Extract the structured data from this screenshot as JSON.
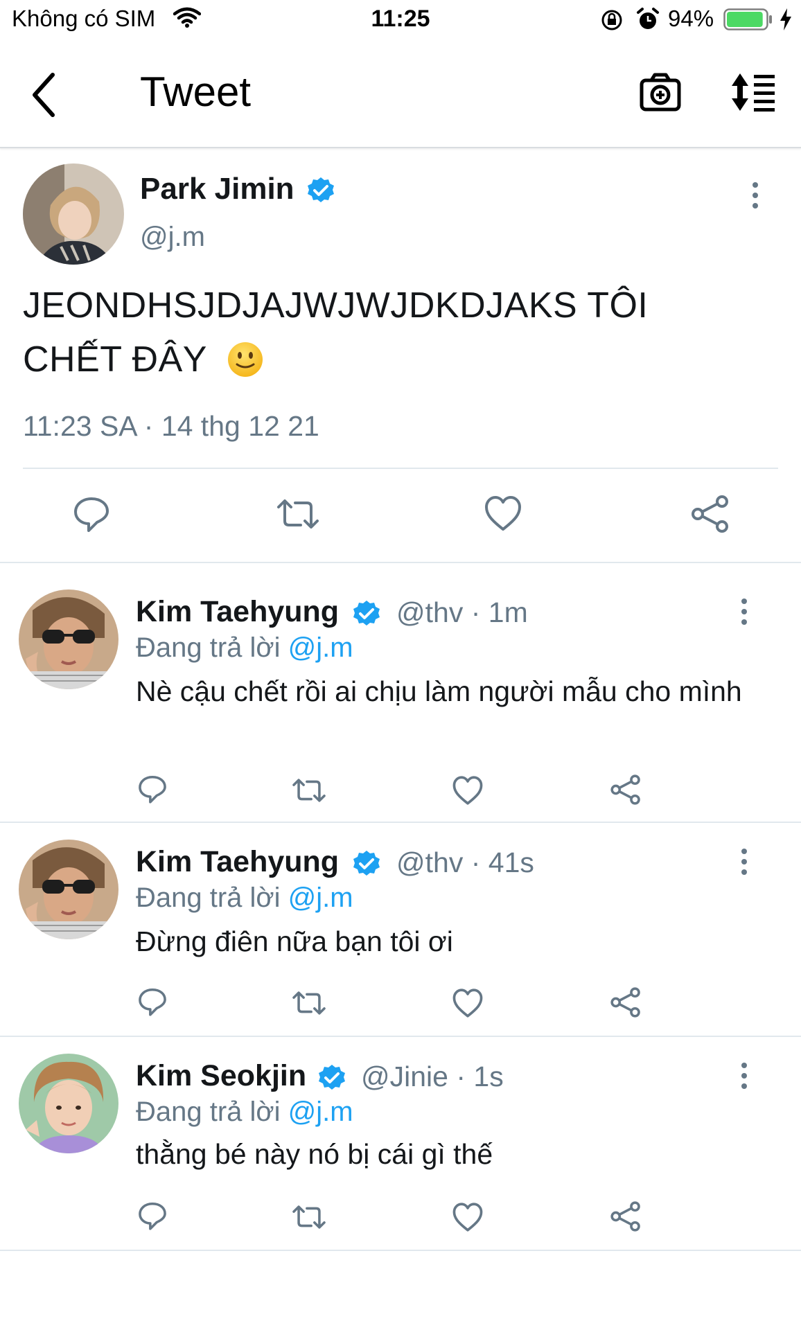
{
  "status_bar": {
    "carrier": "Không có SIM",
    "time": "11:25",
    "battery_percent": "94%",
    "battery_level": 0.94
  },
  "nav": {
    "title": "Tweet",
    "back_icon": "chevron-left-icon",
    "camera_icon": "camera-plus-icon",
    "sort_icon": "sort-list-icon"
  },
  "main_tweet": {
    "name": "Park Jimin",
    "handle": "@j.m",
    "text_line1": "JEONDHSJDJAJWJWJDKDJAKS TÔI",
    "text_line2": "CHẾT ĐÂY",
    "emoji": "🙂",
    "timestamp": "11:23 SA · 14 thg 12 21",
    "verified": true
  },
  "replies": [
    {
      "name": "Kim Taehyung",
      "handle": "@thv",
      "time": "1m",
      "replying_prefix": "Đang trả lời",
      "replying_to": "@j.m",
      "text": "Nè cậu chết rồi ai chịu làm người mẫu cho mình"
    },
    {
      "name": "Kim Taehyung",
      "handle": "@thv",
      "time": "41s",
      "replying_prefix": "Đang trả lời",
      "replying_to": "@j.m",
      "text": "Đừng điên nữa bạn tôi ơi"
    },
    {
      "name": "Kim Seokjin",
      "handle": "@Jinie",
      "time": "1s",
      "replying_prefix": "Đang trả lời",
      "replying_to": "@j.m",
      "text": "thằng bé này nó bị cái gì thế"
    }
  ],
  "colors": {
    "accent": "#1da1f2",
    "secondary_text": "#657786",
    "divider": "#e1e8ed",
    "battery": "#4cd964"
  }
}
